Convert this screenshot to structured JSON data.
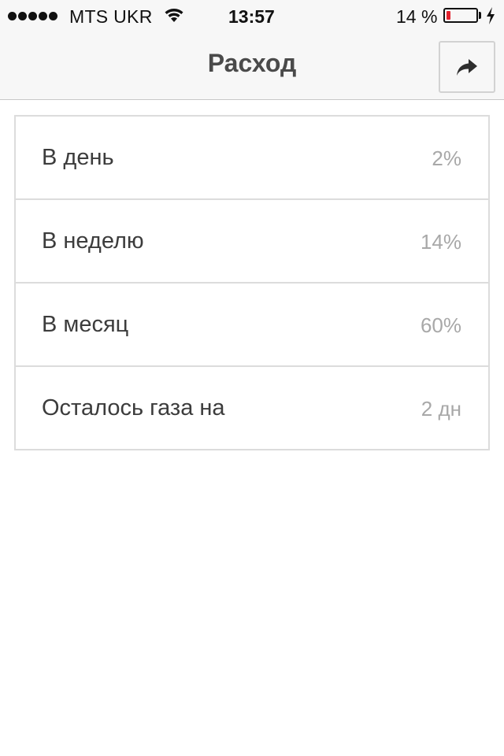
{
  "status_bar": {
    "carrier": "MTS UKR",
    "time": "13:57",
    "battery_percent": "14 %",
    "battery_level": 0.14,
    "battery_color": "#e3232f"
  },
  "nav": {
    "title": "Расход",
    "share_icon": "share-arrow-icon"
  },
  "rows": [
    {
      "label": "В день",
      "value": "2%"
    },
    {
      "label": "В неделю",
      "value": "14%"
    },
    {
      "label": "В месяц",
      "value": "60%"
    },
    {
      "label": "Осталось газа на",
      "value": "2 дн"
    }
  ]
}
